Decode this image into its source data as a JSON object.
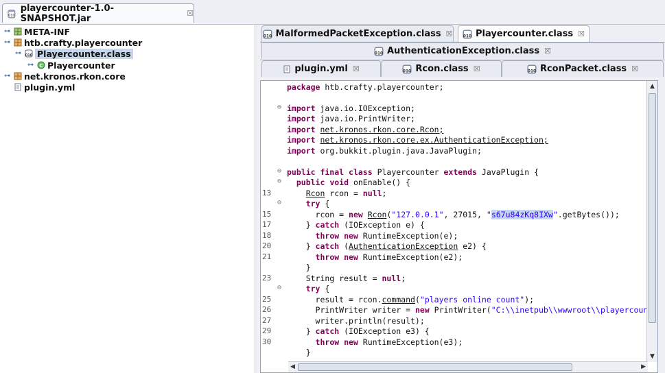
{
  "window": {
    "tab_title": "playercounter-1.0-SNAPSHOT.jar",
    "close": "☒"
  },
  "tree": {
    "items": [
      {
        "label": "META-INF"
      },
      {
        "label": "htb.crafty.playercounter"
      },
      {
        "label": "Playercounter.class"
      },
      {
        "label": "Playercounter"
      },
      {
        "label": "net.kronos.rkon.core"
      },
      {
        "label": "plugin.yml"
      }
    ]
  },
  "editor_tabs": {
    "row1": [
      {
        "label": "MalformedPacketException.class"
      },
      {
        "label": "Playercounter.class"
      }
    ],
    "row2": [
      {
        "label": "AuthenticationException.class"
      }
    ],
    "row3": [
      {
        "label": "plugin.yml"
      },
      {
        "label": "Rcon.class"
      },
      {
        "label": "RconPacket.class"
      }
    ]
  },
  "code": {
    "line_numbers": [
      "13",
      "15",
      "17",
      "18",
      "20",
      "21",
      "23",
      "25",
      "26",
      "27",
      "29",
      "30"
    ],
    "package_stmt": "htb.crafty.playercounter;",
    "imports": [
      "java.io.IOException;",
      "java.io.PrintWriter;",
      "net.kronos.rkon.core.Rcon;",
      "net.kronos.rkon.core.ex.AuthenticationException;",
      "org.bukkit.plugin.java.JavaPlugin;"
    ],
    "class_name": "Playercounter",
    "extends": "JavaPlugin",
    "host": "\"127.0.0.1\"",
    "port": "27015",
    "password": "s67u84zKq8IXw",
    "command": "\"players online count\"",
    "path": "\"C:\\\\inetpub\\\\wwwroot\\\\playercoun"
  },
  "colors": {
    "keyword": "#7f0055",
    "string": "#2a00ff",
    "selection": "#c6d6ec"
  }
}
